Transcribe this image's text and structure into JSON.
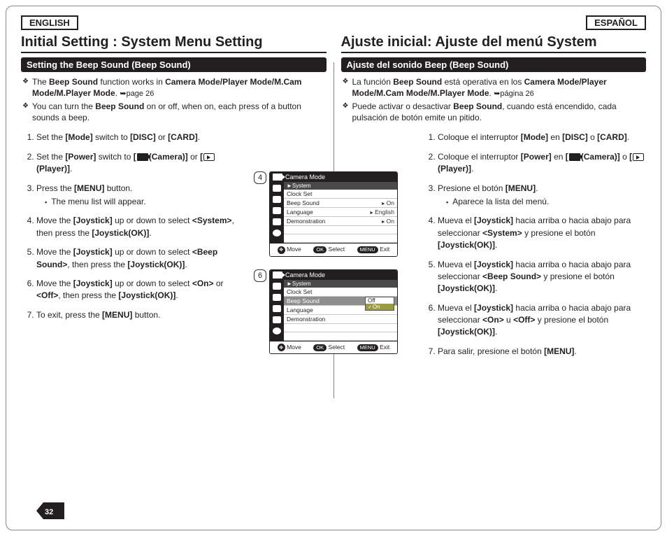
{
  "lang": {
    "left": "ENGLISH",
    "right": "ESPAÑOL"
  },
  "page_number": "32",
  "en": {
    "title": "Initial Setting : System Menu Setting",
    "subhead": "Setting the Beep Sound (Beep Sound)",
    "bullets": {
      "b1_pre": "The ",
      "b1_bold1": "Beep Sound",
      "b1_mid": " function works in ",
      "b1_bold2": "Camera Mode/Player Mode/M.Cam Mode/M.Player Mode",
      "b1_post": ". ",
      "b1_ref": "➥page 26",
      "b2_pre": "You can turn the ",
      "b2_bold": "Beep Sound",
      "b2_post": " on or off, when on, each press of a button sounds a beep."
    },
    "steps": {
      "s1_a": "Set the ",
      "s1_b": "[Mode]",
      "s1_c": " switch to ",
      "s1_d": "[DISC]",
      "s1_e": " or ",
      "s1_f": "[CARD]",
      "s1_g": ".",
      "s2_a": "Set the ",
      "s2_b": "[Power]",
      "s2_c": " switch to ",
      "s2_d": "[",
      "s2_e": "(Camera)]",
      "s2_f": " or ",
      "s2_g": "[",
      "s2_h": "(Player)]",
      "s2_i": ".",
      "s3_a": "Press the ",
      "s3_b": "[MENU]",
      "s3_c": " button.",
      "s3_sub": "The menu list will appear.",
      "s4_a": "Move the ",
      "s4_b": "[Joystick]",
      "s4_c": " up or down to select ",
      "s4_d": "<System>",
      "s4_e": ", then press the ",
      "s4_f": "[Joystick(OK)]",
      "s4_g": ".",
      "s5_a": "Move the ",
      "s5_b": "[Joystick]",
      "s5_c": " up or down to select ",
      "s5_d": "<Beep Sound>",
      "s5_e": ", then press the ",
      "s5_f": "[Joystick(OK)]",
      "s5_g": ".",
      "s6_a": "Move the ",
      "s6_b": "[Joystick]",
      "s6_c": " up or down to select ",
      "s6_d": "<On>",
      "s6_e": " or ",
      "s6_f": "<Off>",
      "s6_g": ", then press the ",
      "s6_h": "[Joystick(OK)]",
      "s6_i": ".",
      "s7_a": "To exit, press the ",
      "s7_b": "[MENU]",
      "s7_c": " button."
    }
  },
  "es": {
    "title": "Ajuste inicial: Ajuste del menú System",
    "subhead": "Ajuste del sonido Beep (Beep Sound)",
    "bullets": {
      "b1_pre": "La función ",
      "b1_bold1": "Beep Sound",
      "b1_mid": " está operativa en los ",
      "b1_bold2": "Camera Mode/Player Mode/M.Cam Mode/M.Player Mode",
      "b1_post": ". ",
      "b1_ref": "➥página 26",
      "b2_pre": "Puede activar o desactivar ",
      "b2_bold": "Beep Sound",
      "b2_post": ", cuando está encendido, cada pulsación de botón emite un pitido."
    },
    "steps": {
      "s1_a": "Coloque el interruptor ",
      "s1_b": "[Mode]",
      "s1_c": " en ",
      "s1_d": "[DISC]",
      "s1_e": " o ",
      "s1_f": "[CARD]",
      "s1_g": ".",
      "s2_a": "Coloque el interruptor ",
      "s2_b": "[Power]",
      "s2_c": " en ",
      "s2_d": "[",
      "s2_e": "(Camera)]",
      "s2_f": " o ",
      "s2_g": "[",
      "s2_h": "(Player)]",
      "s2_i": ".",
      "s3_a": "Presione el botón ",
      "s3_b": "[MENU]",
      "s3_c": ".",
      "s3_sub": "Aparece la lista del menú.",
      "s4_a": "Mueva el ",
      "s4_b": "[Joystick]",
      "s4_c": " hacia arriba o hacia abajo para seleccionar ",
      "s4_d": "<System>",
      "s4_e": " y presione el botón ",
      "s4_f": "[Joystick(OK)]",
      "s4_g": ".",
      "s5_a": "Mueva el ",
      "s5_b": "[Joystick]",
      "s5_c": " hacia arriba o hacia abajo para seleccionar ",
      "s5_d": "<Beep Sound>",
      "s5_e": " y presione el botón ",
      "s5_f": "[Joystick(OK)]",
      "s5_g": ".",
      "s6_a": "Mueva el ",
      "s6_b": "[Joystick]",
      "s6_c": " hacia arriba o hacia abajo para seleccionar ",
      "s6_d": "<On>",
      "s6_e": " u ",
      "s6_f": "<Off>",
      "s6_g": " y presione el botón ",
      "s6_h": "[Joystick(OK)]",
      "s6_i": ".",
      "s7_a": "Para salir, presione el botón ",
      "s7_b": "[MENU]",
      "s7_c": "."
    }
  },
  "osd": {
    "step4": "4",
    "step6": "6",
    "title": "Camera Mode",
    "crumb": "►System",
    "rows": {
      "clock": "Clock Set",
      "beep": "Beep Sound",
      "lang": "Language",
      "demo": "Demonstration"
    },
    "vals4": {
      "beep": "On",
      "lang": "English",
      "demo": "On"
    },
    "opts6": {
      "off": "Off",
      "on": "On"
    },
    "footer": {
      "move": "Move",
      "select": "Select",
      "exit": "Exit",
      "ok": "OK",
      "menu": "MENU"
    }
  }
}
